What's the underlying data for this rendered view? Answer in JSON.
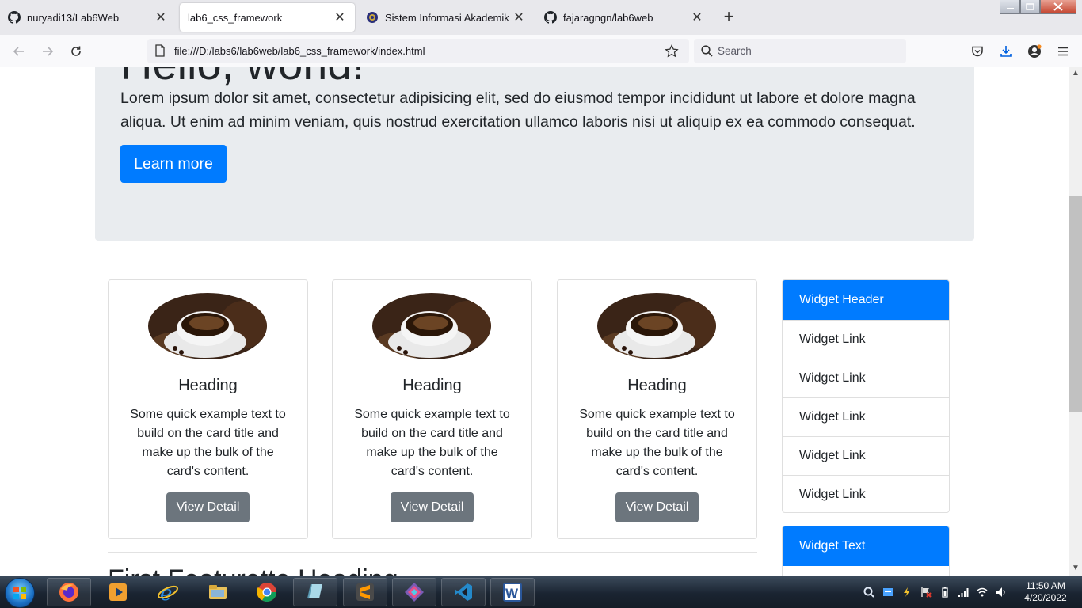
{
  "browser": {
    "tabs": [
      {
        "title": "nuryadi13/Lab6Web",
        "icon": "github-icon",
        "active": false
      },
      {
        "title": "lab6_css_framework",
        "icon": "none",
        "active": true
      },
      {
        "title": "Sistem Informasi Akademik",
        "icon": "university-icon",
        "active": false
      },
      {
        "title": "fajaragngn/lab6web",
        "icon": "github-icon",
        "active": false
      }
    ],
    "url": "file:///D:/labs6/lab6web/lab6_css_framework/index.html",
    "search_placeholder": "Search"
  },
  "page": {
    "jumbotron": {
      "title": "Hello, world!",
      "lead": "Lorem ipsum dolor sit amet, consectetur adipisicing elit, sed do eiusmod tempor incididunt ut labore et dolore magna aliqua. Ut enim ad minim veniam, quis nostrud exercitation ullamco laboris nisi ut aliquip ex ea commodo consequat.",
      "button": "Learn more"
    },
    "cards": [
      {
        "title": "Heading",
        "text": "Some quick example text to build on the card title and make up the bulk of the card's content.",
        "button": "View Detail"
      },
      {
        "title": "Heading",
        "text": "Some quick example text to build on the card title and make up the bulk of the card's content.",
        "button": "View Detail"
      },
      {
        "title": "Heading",
        "text": "Some quick example text to build on the card title and make up the bulk of the card's content.",
        "button": "View Detail"
      }
    ],
    "featurette_heading": "First Featurette Heading",
    "widget_links": {
      "header": "Widget Header",
      "links": [
        "Widget Link",
        "Widget Link",
        "Widget Link",
        "Widget Link",
        "Widget Link"
      ]
    },
    "widget_text": {
      "header": "Widget Text"
    }
  },
  "taskbar": {
    "time": "11:50 AM",
    "date": "4/20/2022"
  },
  "colors": {
    "primary": "#007bff",
    "secondary": "#6c757d",
    "jumbotron_bg": "#e9ecef"
  }
}
